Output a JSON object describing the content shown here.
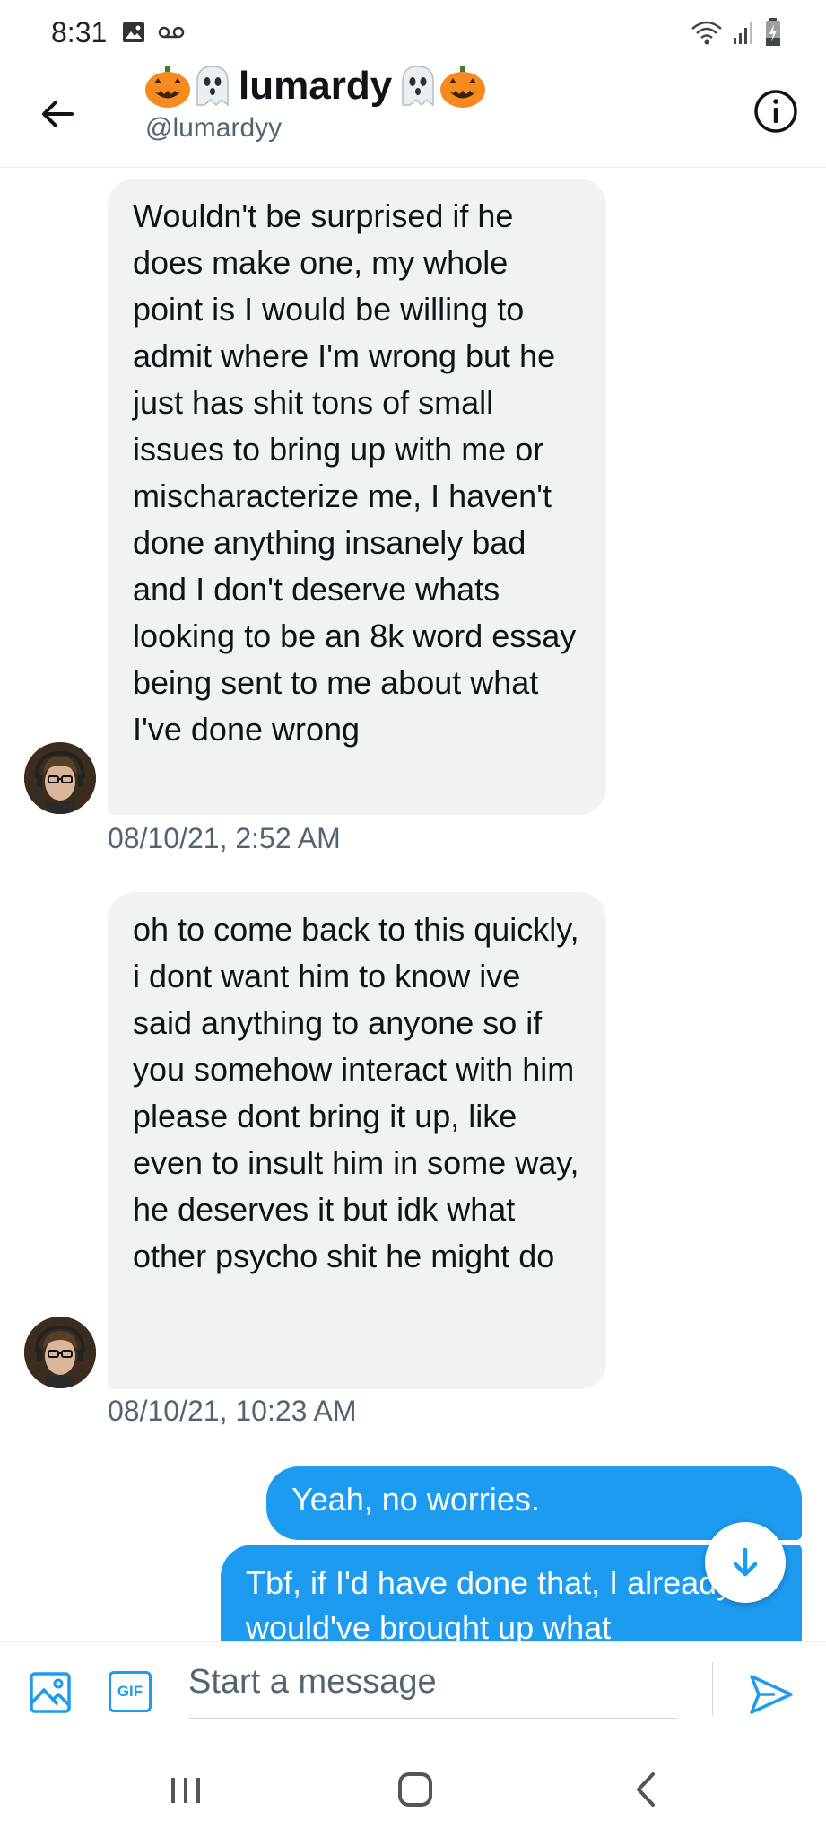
{
  "status_bar": {
    "time": "8:31"
  },
  "header": {
    "display_name": "lumardy",
    "handle": "@lumardyy"
  },
  "messages": [
    {
      "direction": "incoming",
      "text": "Wouldn't be surprised if he does make one, my whole point is I would be willing to admit where I'm wrong but he just has shit tons of small issues to bring up with me or mischaracterize me, I haven't done anything insanely bad and I don't deserve whats looking to be an 8k word essay being sent to me about what I've done wrong",
      "timestamp": "08/10/21, 2:52 AM"
    },
    {
      "direction": "incoming",
      "text": "oh to come back to this quickly, i dont want him to know ive said anything to anyone so if you somehow interact with him please dont bring it up, like even to insult him in some way, he deserves it but idk what other psycho shit he might do",
      "timestamp": "08/10/21, 10:23 AM"
    },
    {
      "direction": "outgoing",
      "text": "Yeah, no worries."
    },
    {
      "direction": "outgoing",
      "text": "Tbf, if I'd have done that, I already would've brought up what"
    }
  ],
  "composer": {
    "placeholder": "Start a message",
    "gif_label": "GIF"
  },
  "colors": {
    "accent": "#1d9bf0",
    "incoming_bubble": "#eff3f4",
    "secondary_text": "#536471"
  }
}
